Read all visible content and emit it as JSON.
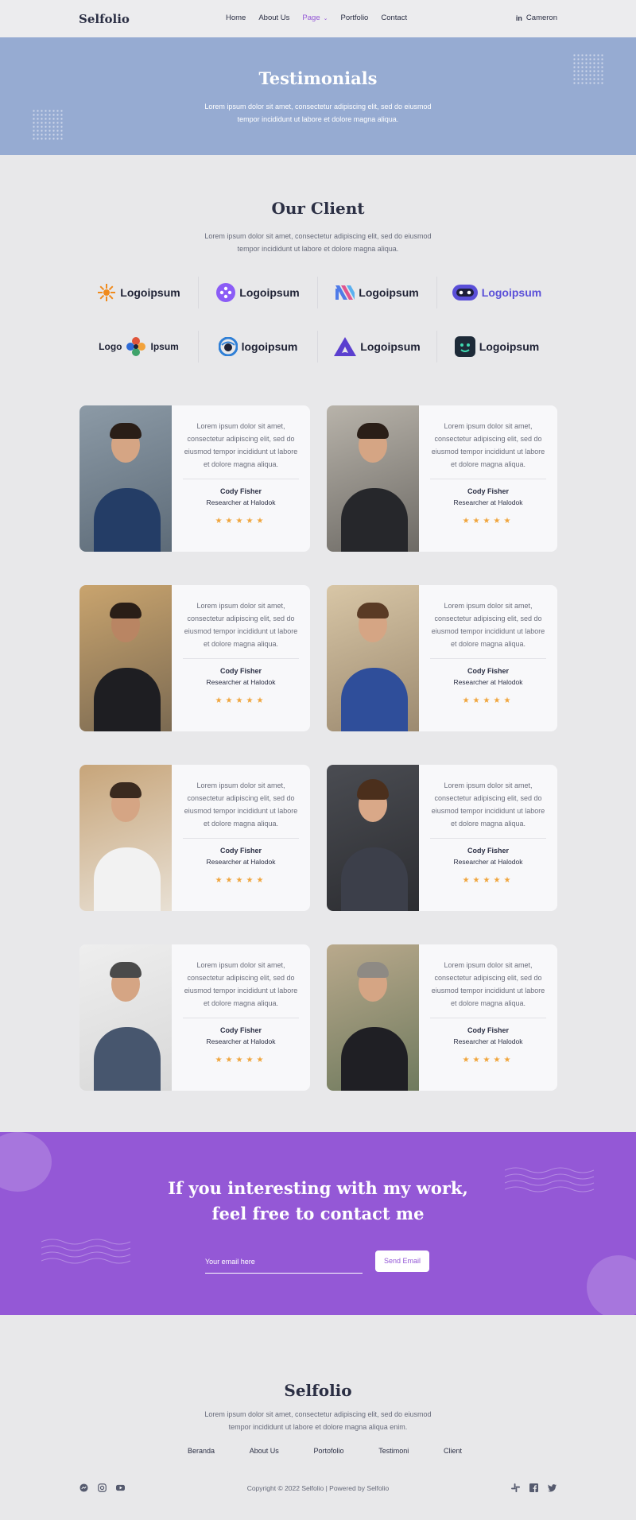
{
  "nav": {
    "brand": "Selfolio",
    "items": [
      {
        "label": "Home"
      },
      {
        "label": "About Us"
      },
      {
        "label": "Page"
      },
      {
        "label": "Portfolio"
      },
      {
        "label": "Contact"
      }
    ],
    "active_item": "Page",
    "user_label": "Cameron",
    "user_icon": "linkedin-icon"
  },
  "hero": {
    "title": "Testimonials",
    "subtitle": "Lorem ipsum dolor sit amet, consectetur adipiscing elit, sed do eiusmod tempor incididunt ut labore et dolore magna aliqua."
  },
  "clients": {
    "title": "Our Client",
    "subtitle": "Lorem ipsum dolor sit amet, consectetur adipiscing elit, sed do eiusmod tempor incididunt ut labore et dolore magna aliqua.",
    "logos": [
      {
        "text": "Logoipsum",
        "icon": "sun-icon",
        "color": "#f08a1c"
      },
      {
        "text": "Logoipsum",
        "icon": "gamepad-icon",
        "color": "#8b5cf6"
      },
      {
        "text": "Logoipsum",
        "icon": "stripes-icon",
        "color": "#4f7be8"
      },
      {
        "text": "Logoipsum",
        "icon": "robot-icon",
        "color": "#5a4fd8"
      },
      {
        "text": "Logo",
        "text2": "Ipsum",
        "icon": "flower-icon",
        "color": "#e0553a"
      },
      {
        "text": "logoipsum",
        "icon": "eye-icon",
        "color": "#2f7fd6"
      },
      {
        "text": "Logoipsum",
        "icon": "triangle-icon",
        "color": "#5b3fcf"
      },
      {
        "text": "Logoipsum",
        "icon": "face-icon",
        "color": "#1d2a38"
      }
    ]
  },
  "testimonials": [
    {
      "quote": "Lorem ipsum dolor sit amet, consectetur adipiscing elit, sed do eiusmod tempor incididunt ut labore et dolore magna aliqua.",
      "name": "Cody Fisher",
      "role": "Researcher at Halodok",
      "rating": 5
    },
    {
      "quote": "Lorem ipsum dolor sit amet, consectetur adipiscing elit, sed do eiusmod tempor incididunt ut labore et dolore magna aliqua.",
      "name": "Cody Fisher",
      "role": "Researcher at Halodok",
      "rating": 5
    },
    {
      "quote": "Lorem ipsum dolor sit amet, consectetur adipiscing elit, sed do eiusmod tempor incididunt ut labore et dolore magna aliqua.",
      "name": "Cody Fisher",
      "role": "Researcher at Halodok",
      "rating": 5
    },
    {
      "quote": "Lorem ipsum dolor sit amet, consectetur adipiscing elit, sed do eiusmod tempor incididunt ut labore et dolore magna aliqua.",
      "name": "Cody Fisher",
      "role": "Researcher at Halodok",
      "rating": 5
    },
    {
      "quote": "Lorem ipsum dolor sit amet, consectetur adipiscing elit, sed do eiusmod tempor incididunt ut labore et dolore magna aliqua.",
      "name": "Cody Fisher",
      "role": "Researcher at Halodok",
      "rating": 5
    },
    {
      "quote": "Lorem ipsum dolor sit amet, consectetur adipiscing elit, sed do eiusmod tempor incididunt ut labore et dolore magna aliqua.",
      "name": "Cody Fisher",
      "role": "Researcher at Halodok",
      "rating": 5
    },
    {
      "quote": "Lorem ipsum dolor sit amet, consectetur adipiscing elit, sed do eiusmod tempor incididunt ut labore et dolore magna aliqua.",
      "name": "Cody Fisher",
      "role": "Researcher at Halodok",
      "rating": 5
    },
    {
      "quote": "Lorem ipsum dolor sit amet, consectetur adipiscing elit, sed do eiusmod tempor incididunt ut labore et dolore magna aliqua.",
      "name": "Cody Fisher",
      "role": "Researcher at Halodok",
      "rating": 5
    }
  ],
  "cta": {
    "title_line1": "If you interesting with my work,",
    "title_line2": "feel free to contact me",
    "email_placeholder": "Your email here",
    "send_label": "Send Email"
  },
  "footer": {
    "brand": "Selfolio",
    "subtitle": "Lorem ipsum dolor sit amet, consectetur adipiscing elit, sed do eiusmod tempor incididunt ut labore et dolore magna aliqua enim.",
    "links": [
      {
        "label": "Beranda"
      },
      {
        "label": "About Us"
      },
      {
        "label": "Portofolio"
      },
      {
        "label": "Testimoni"
      },
      {
        "label": "Client"
      }
    ],
    "copyright": "Copyright © 2022 Selfolio | Powered by Selfolio",
    "social_left": [
      "messenger-icon",
      "instagram-icon",
      "youtube-icon"
    ],
    "social_right": [
      "slack-icon",
      "facebook-icon",
      "twitter-icon"
    ]
  },
  "colors": {
    "accent": "#9458d6",
    "hero": "#96abd2",
    "star": "#f0a53c",
    "text": "#2b2f44",
    "background": "#e8e8ea"
  }
}
